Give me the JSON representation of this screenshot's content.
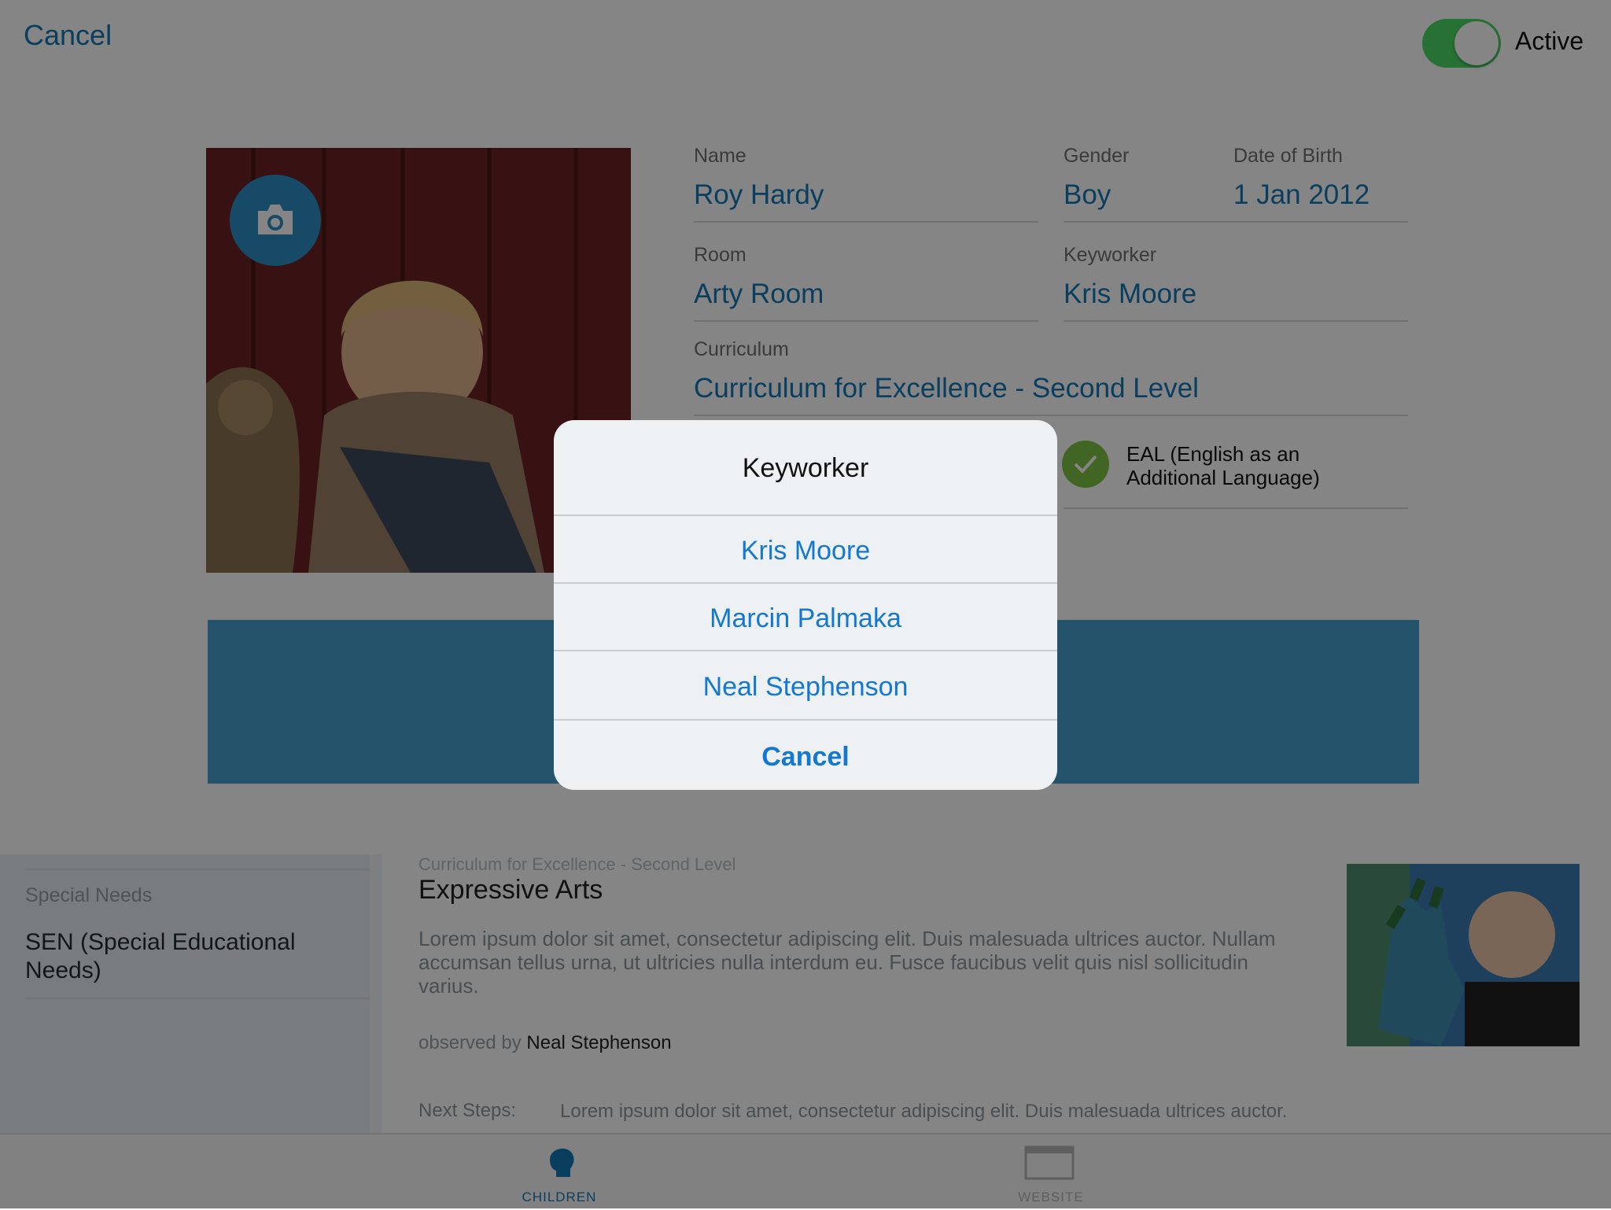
{
  "top_bar": {
    "cancel_label": "Cancel",
    "active_toggle_on": true,
    "active_label": "Active"
  },
  "profile": {
    "fields": {
      "name_label": "Name",
      "name_value": "Roy Hardy",
      "gender_label": "Gender",
      "gender_value": "Boy",
      "dob_label": "Date of Birth",
      "dob_value": "1 Jan 2012",
      "room_label": "Room",
      "room_value": "Arty Room",
      "keyworker_label": "Keyworker",
      "keyworker_value": "Kris Moore",
      "curriculum_label": "Curriculum",
      "curriculum_value": "Curriculum for Excellence - Second Level"
    },
    "eal_label": "EAL (English as an Additional Language)",
    "eal_checked": true
  },
  "background": {
    "special_needs_label": "Special Needs",
    "special_needs_value": "SEN (Special Educational Needs)",
    "observation_subtitle": "Curriculum for Excellence - Second Level",
    "observation_title": "Expressive Arts",
    "observation_body": "Lorem ipsum dolor sit amet, consectetur adipiscing elit. Duis malesuada ultrices auctor. Nullam accumsan tellus urna, ut ultricies nulla interdum eu. Fusce faucibus velit quis nisl sollicitudin varius.",
    "observed_by_prefix": "observed by",
    "observed_by_name": "Neal Stephenson",
    "next_steps_label": "Next Steps:",
    "next_steps_text": "Lorem ipsum dolor sit amet, consectetur adipiscing elit. Duis malesuada ultrices auctor."
  },
  "tab_bar": {
    "tabs": [
      {
        "label": "CHILDREN",
        "icon": "child-head-icon",
        "selected": true
      },
      {
        "label": "WEBSITE",
        "icon": "browser-window-icon",
        "selected": false
      }
    ]
  },
  "keyworker_sheet": {
    "title": "Keyworker",
    "options": [
      "Kris Moore",
      "Marcin Palmaka",
      "Neal Stephenson"
    ],
    "cancel_label": "Cancel"
  },
  "colors": {
    "accent": "#1478b6",
    "toggle_on": "#4cd964",
    "eal_check": "#7dc242",
    "band": "#4a9fd0"
  }
}
